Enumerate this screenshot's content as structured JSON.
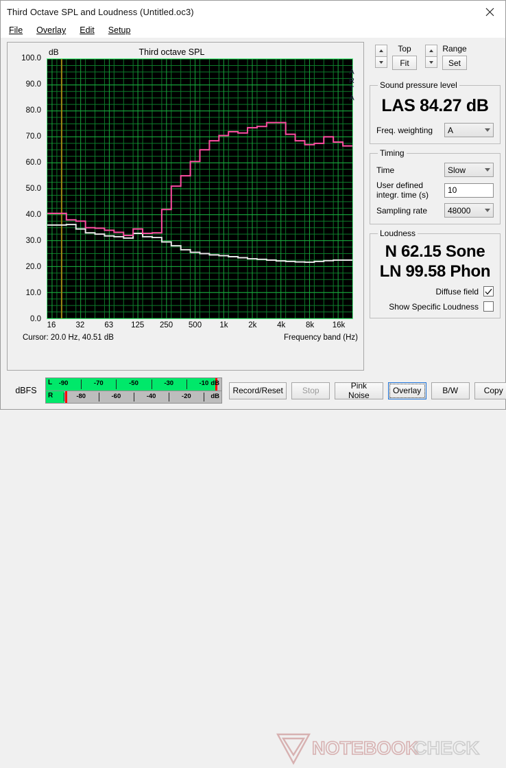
{
  "window": {
    "title": "Third Octave SPL and Loudness (Untitled.oc3)",
    "close_icon": "close-icon"
  },
  "menu": {
    "items": [
      {
        "label": "File"
      },
      {
        "label": "Overlay"
      },
      {
        "label": "Edit"
      },
      {
        "label": "Setup"
      }
    ]
  },
  "graph": {
    "title": "Third octave SPL",
    "y_axis_unit": "dB",
    "x_axis_label": "Frequency band (Hz)",
    "cursor_text": "Cursor:   20.0 Hz, 40.51 dB",
    "watermark_letters": [
      "A",
      "R",
      "T",
      "A"
    ]
  },
  "controls": {
    "top": {
      "label": "Top",
      "button": "Fit"
    },
    "range": {
      "label": "Range",
      "button": "Set"
    }
  },
  "spl": {
    "legend": "Sound pressure level",
    "value": "LAS 84.27 dB",
    "weighting_label": "Freq. weighting",
    "weighting_value": "A"
  },
  "timing": {
    "legend": "Timing",
    "time_label": "Time",
    "time_value": "Slow",
    "integr_label": "User defined integr. time (s)",
    "integr_label_line1": "User defined",
    "integr_label_line2": "integr. time (s)",
    "integr_value": "10",
    "sampling_label": "Sampling rate",
    "sampling_value": "48000"
  },
  "loudness": {
    "legend": "Loudness",
    "sone": "N 62.15 Sone",
    "phon": "LN 99.58 Phon",
    "diffuse_label": "Diffuse field",
    "diffuse_checked": true,
    "specific_label": "Show Specific Loudness",
    "specific_checked": false
  },
  "meter": {
    "label": "dBFS",
    "unit": "dB",
    "left_channel": "L",
    "right_channel": "R",
    "left_fill_pct": 97.5,
    "left_marker_pct": 97.5,
    "right_fill_pct": 10.5,
    "right_marker_pct": 11.5,
    "top_ticks": [
      "-90",
      "-70",
      "-50",
      "-30",
      "-10"
    ],
    "bottom_ticks": [
      "-80",
      "-60",
      "-40",
      "-20"
    ]
  },
  "buttons": [
    {
      "label": "Record/Reset",
      "state": "normal"
    },
    {
      "label": "Stop",
      "state": "disabled"
    },
    {
      "label": "Pink Noise",
      "state": "normal"
    },
    {
      "label": "Overlay",
      "state": "focused"
    },
    {
      "label": "B/W",
      "state": "normal"
    },
    {
      "label": "Copy",
      "state": "normal"
    }
  ],
  "watermark": {
    "text": "NOTEBOOKCHECK"
  },
  "colors": {
    "plot_background": "#000000",
    "grid": "#0d7a2a",
    "grid_major": "#18a83d",
    "plot_border": "#5ef08a",
    "curve_main": "#ff4fa3",
    "curve_overlay": "#e8e8e8",
    "cursor_line": "#a08a15",
    "meter_green": "#00e86a",
    "meter_red": "#ff0000"
  },
  "chart_data": {
    "type": "line",
    "title": "Third octave SPL",
    "xlabel": "Frequency band (Hz)",
    "ylabel": "dB",
    "ylim": [
      0.0,
      100.0
    ],
    "ytick_step": 10.0,
    "yticks": [
      "0.0",
      "10.0",
      "20.0",
      "30.0",
      "40.0",
      "50.0",
      "60.0",
      "70.0",
      "80.0",
      "90.0",
      "100.0"
    ],
    "xticks": [
      "16",
      "32",
      "63",
      "125",
      "250",
      "500",
      "1k",
      "2k",
      "4k",
      "8k",
      "16k"
    ],
    "grid": true,
    "legend": null,
    "categories": [
      16,
      20,
      25,
      31.5,
      40,
      50,
      63,
      80,
      100,
      125,
      160,
      200,
      250,
      315,
      400,
      500,
      630,
      800,
      1000,
      1250,
      1600,
      2000,
      2500,
      3150,
      4000,
      5000,
      6300,
      8000,
      10000,
      12500,
      16000,
      20000
    ],
    "series": [
      {
        "name": "Third octave SPL",
        "color": "#ff4fa3",
        "values": [
          40.5,
          40.5,
          38.0,
          37.5,
          35.0,
          34.8,
          34.0,
          33.2,
          32.0,
          34.5,
          32.8,
          33.0,
          42.0,
          51.0,
          55.0,
          60.5,
          65.0,
          68.5,
          70.5,
          72.0,
          71.5,
          73.5,
          74.0,
          75.5,
          75.5,
          71.0,
          68.5,
          67.0,
          67.5,
          70.0,
          68.0,
          66.5
        ]
      },
      {
        "name": "Overlay",
        "color": "#e8e8e8",
        "values": [
          36.0,
          36.0,
          36.2,
          34.5,
          33.0,
          32.5,
          31.8,
          31.5,
          31.0,
          32.8,
          31.5,
          31.2,
          29.5,
          28.0,
          26.5,
          25.5,
          25.0,
          24.5,
          24.2,
          23.8,
          23.4,
          23.0,
          22.8,
          22.5,
          22.2,
          22.0,
          21.8,
          21.7,
          22.0,
          22.3,
          22.5,
          22.5
        ]
      }
    ],
    "cursor": {
      "frequency_hz": 20.0,
      "level_db": 40.51
    }
  }
}
